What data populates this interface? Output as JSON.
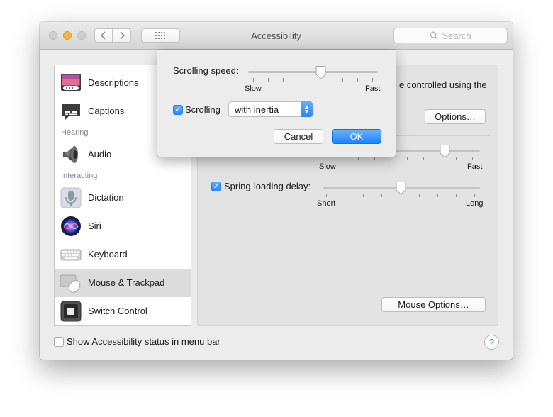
{
  "window": {
    "title": "Accessibility",
    "search_placeholder": "Search",
    "colors": {
      "accent": "#2a8af8",
      "minimize": "#f8b737"
    }
  },
  "sidebar": {
    "items": [
      {
        "label": "Descriptions",
        "icon": "descriptions-icon"
      },
      {
        "label": "Captions",
        "icon": "captions-icon"
      },
      {
        "section": "Hearing"
      },
      {
        "label": "Audio",
        "icon": "speaker-icon"
      },
      {
        "section": "Interacting"
      },
      {
        "label": "Dictation",
        "icon": "microphone-icon"
      },
      {
        "label": "Siri",
        "icon": "siri-icon"
      },
      {
        "label": "Keyboard",
        "icon": "keyboard-icon"
      },
      {
        "label": "Mouse & Trackpad",
        "icon": "mouse-trackpad-icon",
        "selected": true
      },
      {
        "label": "Switch Control",
        "icon": "switch-control-icon"
      }
    ]
  },
  "main": {
    "description_fragment": "e controlled using the",
    "options_button": "Options…",
    "double_click_speed": {
      "min_label": "Slow",
      "max_label": "Fast",
      "value": 0.78
    },
    "spring_loading": {
      "label": "Spring-loading delay:",
      "checked": true,
      "min_label": "Short",
      "max_label": "Long",
      "value": 0.5
    },
    "mouse_options_button": "Mouse Options…"
  },
  "footer": {
    "status_checkbox_label": "Show Accessibility status in menu bar",
    "status_checked": false,
    "help": "?"
  },
  "sheet": {
    "scrolling_speed_label": "Scrolling speed:",
    "speed_min_label": "Slow",
    "speed_max_label": "Fast",
    "speed_value": 0.56,
    "scrolling_label": "Scrolling",
    "scrolling_checked": true,
    "scrolling_mode": "with inertia",
    "cancel_label": "Cancel",
    "ok_label": "OK"
  }
}
